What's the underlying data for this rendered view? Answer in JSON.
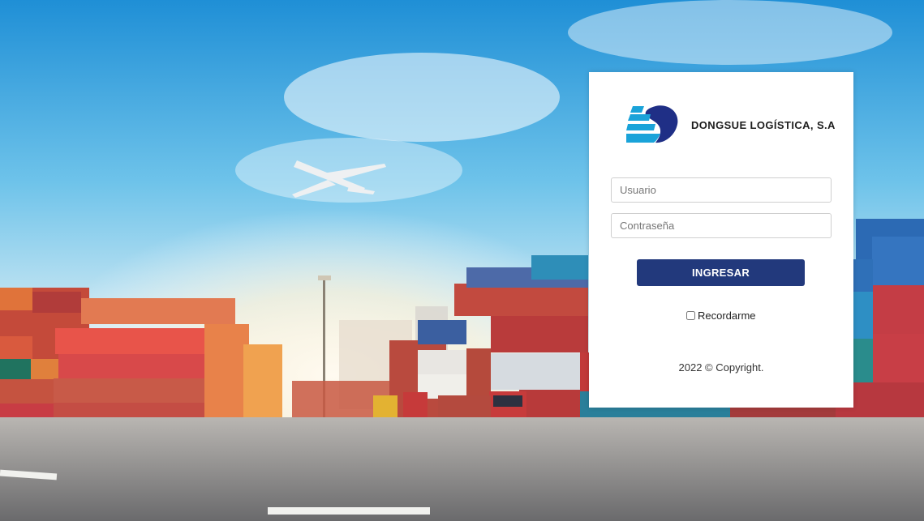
{
  "brand": {
    "name": "DONGSUE LOGÍSTICA, S.A",
    "logo_colors": {
      "navy": "#1f2f86",
      "cyan": "#1aa3d9"
    }
  },
  "login": {
    "username_placeholder": "Usuario",
    "password_placeholder": "Contraseña",
    "submit_label": "INGRESAR",
    "remember_label": "Recordarme",
    "remember_checked": false,
    "button_color": "#22397c"
  },
  "footer": {
    "copyright": "2022 © Copyright."
  }
}
